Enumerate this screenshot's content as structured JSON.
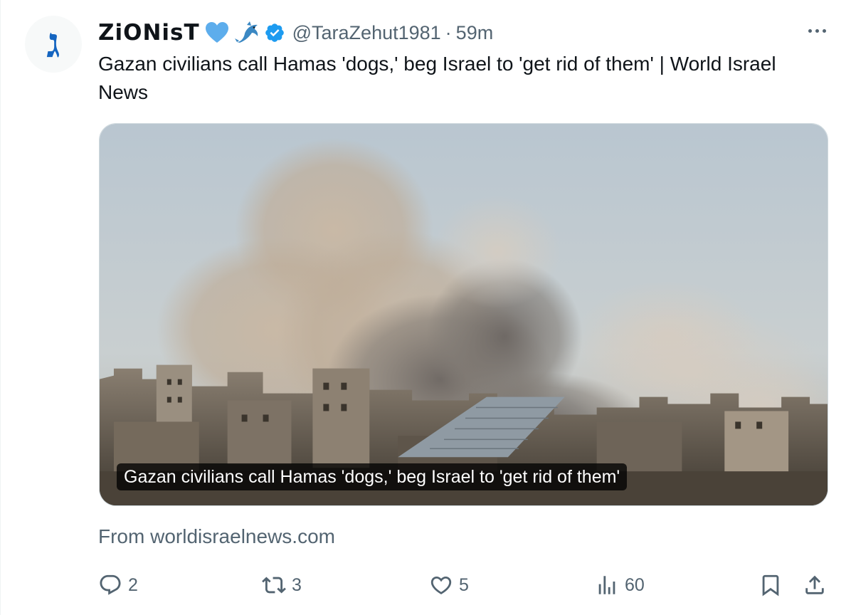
{
  "tweet": {
    "avatar_glyph": "ג",
    "display_name": "ZiONisT",
    "name_emojis": [
      "blue-heart",
      "dolphin"
    ],
    "handle": "@TaraZehut1981",
    "separator": "·",
    "time": "59m",
    "text": "Gazan civilians call Hamas 'dogs,' beg Israel to 'get rid of them' | World Israel News",
    "card": {
      "caption": "Gazan civilians call Hamas 'dogs,' beg Israel to 'get rid of them'"
    },
    "source": "From worldisraelnews.com",
    "metrics": {
      "replies": "2",
      "reposts": "3",
      "likes": "5",
      "views": "60"
    }
  },
  "colors": {
    "text_primary": "#0f1419",
    "text_secondary": "#536471",
    "verified": "#1d9bf0",
    "avatar_glyph": "#1565c0"
  }
}
